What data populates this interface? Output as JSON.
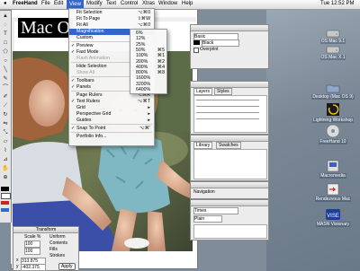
{
  "menubar": {
    "apple": "",
    "items": [
      "FreeHand",
      "File",
      "Edit",
      "View",
      "Modify",
      "Text",
      "Control",
      "Xtras",
      "Window",
      "Help"
    ],
    "active": "View",
    "clock": "Tue 12:52 PM"
  },
  "view_menu": {
    "items": [
      {
        "label": "Fit Selection",
        "shortcut": "⌥⌘0",
        "checked": false,
        "disabled": false,
        "highlighted": false
      },
      {
        "label": "Fit To Page",
        "shortcut": "⇧⌘W",
        "checked": false,
        "disabled": false,
        "highlighted": false
      },
      {
        "label": "Fit All",
        "shortcut": "⌥⌘0",
        "checked": false,
        "disabled": false,
        "highlighted": false
      },
      {
        "label": "Magnification",
        "shortcut": "▸",
        "checked": false,
        "disabled": false,
        "highlighted": true
      },
      {
        "label": "Custom",
        "shortcut": "▸",
        "checked": false,
        "disabled": false,
        "highlighted": false
      },
      {
        "label": "Preview",
        "shortcut": "⌘K",
        "checked": true,
        "disabled": false,
        "highlighted": false
      },
      {
        "label": "Fast Mode",
        "shortcut": "⇧⌘K",
        "checked": true,
        "disabled": false,
        "highlighted": false
      },
      {
        "label": "Flash Animation",
        "shortcut": "⌥⌘K",
        "checked": false,
        "disabled": true,
        "highlighted": false
      },
      {
        "label": "Hide Selection",
        "shortcut": "",
        "checked": false,
        "disabled": false,
        "highlighted": false
      },
      {
        "label": "Show All",
        "shortcut": "",
        "checked": false,
        "disabled": true,
        "highlighted": false
      },
      {
        "label": "Toolbars",
        "shortcut": "⌥⌘T",
        "checked": true,
        "disabled": false,
        "highlighted": false
      },
      {
        "label": "Panels",
        "shortcut": "F4",
        "checked": true,
        "disabled": false,
        "highlighted": false
      },
      {
        "label": "Page Rulers",
        "shortcut": "⌥⌘R",
        "checked": false,
        "disabled": false,
        "highlighted": false
      },
      {
        "label": "Text Rulers",
        "shortcut": "⌥⌘T",
        "checked": true,
        "disabled": false,
        "highlighted": false
      },
      {
        "label": "Grid",
        "shortcut": "▸",
        "checked": false,
        "disabled": false,
        "highlighted": false
      },
      {
        "label": "Perspective Grid",
        "shortcut": "▸",
        "checked": false,
        "disabled": false,
        "highlighted": false
      },
      {
        "label": "Guides",
        "shortcut": "▸",
        "checked": false,
        "disabled": false,
        "highlighted": false
      },
      {
        "label": "Snap To Point",
        "shortcut": "⌥⌘'",
        "checked": true,
        "disabled": false,
        "highlighted": false
      },
      {
        "label": "Portfolio Info...",
        "shortcut": "",
        "checked": false,
        "disabled": false,
        "highlighted": false
      }
    ]
  },
  "magnification_submenu": {
    "items": [
      {
        "label": "6%",
        "shortcut": ""
      },
      {
        "label": "12%",
        "shortcut": ""
      },
      {
        "label": "25%",
        "shortcut": ""
      },
      {
        "label": "50%",
        "shortcut": "⌘5"
      },
      {
        "label": "100%",
        "shortcut": "⌘1"
      },
      {
        "label": "200%",
        "shortcut": "⌘2"
      },
      {
        "label": "400%",
        "shortcut": "⌘4"
      },
      {
        "label": "800%",
        "shortcut": "⌘8"
      },
      {
        "label": "1600%",
        "shortcut": ""
      },
      {
        "label": "3200%",
        "shortcut": ""
      },
      {
        "label": "6400%",
        "shortcut": ""
      }
    ]
  },
  "document": {
    "headline": "Mac O"
  },
  "stroke_panel": {
    "rows": [
      "Basic",
      "Black",
      "Overprint"
    ]
  },
  "layers_panel": {
    "tabs": [
      "Layers",
      "Styles"
    ]
  },
  "library_panel": {
    "tabs": [
      "Library",
      "Swatches"
    ]
  },
  "navigation_panel": {
    "tabs": [
      "Navigation"
    ]
  },
  "text_panel": {
    "font": "Times",
    "style": "Plain"
  },
  "transform_panel": {
    "title": "Transform",
    "scale_label": "Scale %",
    "value1": "100",
    "value2": "100",
    "options": [
      "Contents",
      "Fills",
      "Strokes"
    ],
    "x_label": "x",
    "x_value": "313.875",
    "y_label": "y",
    "y_value": "-402.375",
    "apply": "Apply",
    "uniform": "Uniform"
  },
  "desktop": {
    "icons": [
      {
        "label": "OS Mac 9.1",
        "icon": "hard-drive-icon"
      },
      {
        "label": "OS Mac X.1",
        "icon": "hard-drive-icon"
      },
      {
        "label": "Desktop (Mac OS 9)",
        "icon": "folder-icon"
      },
      {
        "label": "Lightning Workshop",
        "icon": "app-icon"
      },
      {
        "label": "FreeHand 10",
        "icon": "cd-icon"
      },
      {
        "label": "Macromedia",
        "icon": "app-icon"
      },
      {
        "label": "Rendezvous Mac",
        "icon": "app-icon"
      },
      {
        "label": "MASN Visionary",
        "icon": "app-icon"
      }
    ]
  },
  "colors": {
    "menu_highlight": "#3465c9",
    "desktop_blue": "#7a8896",
    "panel_bg": "#ececec"
  }
}
